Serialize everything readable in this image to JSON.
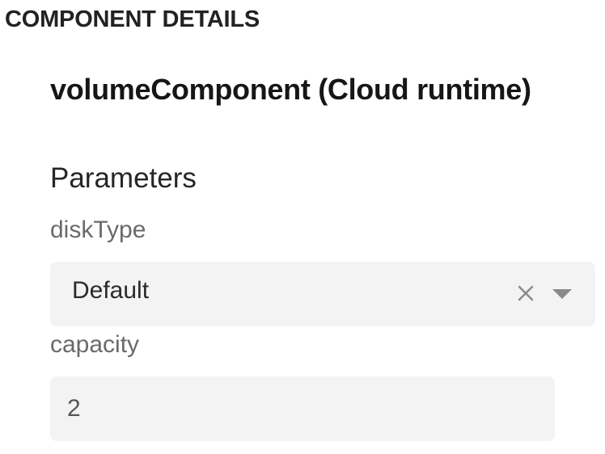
{
  "section": {
    "title": "COMPONENT DETAILS"
  },
  "component": {
    "title": "volumeComponent (Cloud runtime)"
  },
  "parameters": {
    "heading": "Parameters",
    "disk_type": {
      "label": "diskType",
      "value": "Default",
      "clear_icon": "close-icon",
      "dropdown_icon": "chevron-down-icon"
    },
    "capacity": {
      "label": "capacity",
      "value": "2"
    }
  },
  "colors": {
    "field_background": "#f3f3f3",
    "label_text": "#6a6a6a",
    "icon_gray": "#8a8a8a"
  }
}
